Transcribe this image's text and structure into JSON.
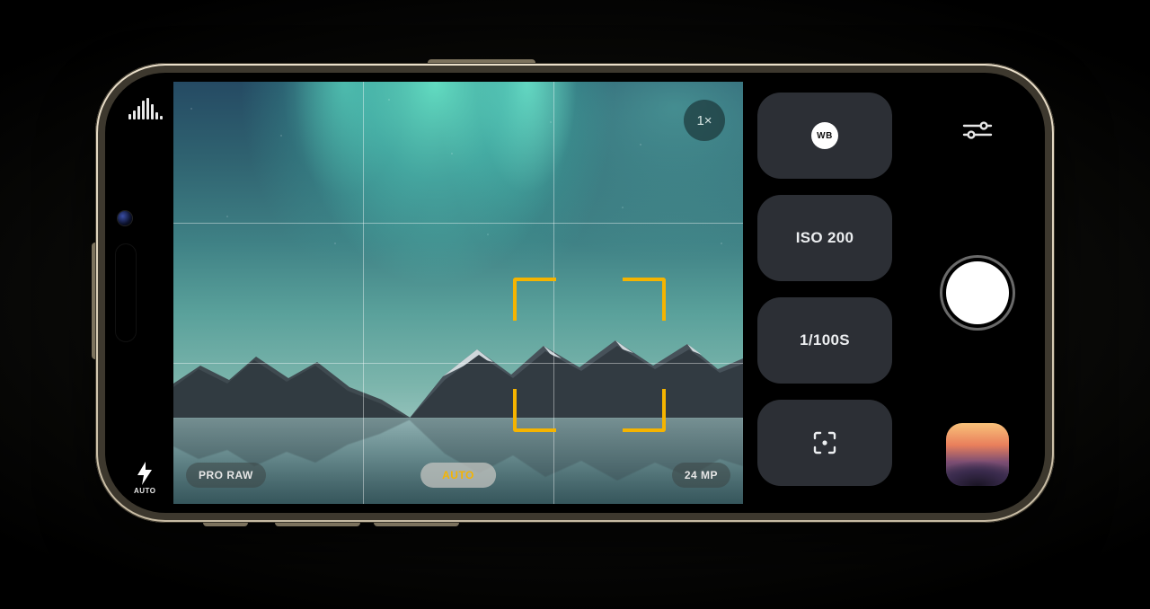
{
  "status": {
    "flash_mode": "AUTO"
  },
  "viewfinder": {
    "zoom_label": "1×",
    "format_pill": "PRO RAW",
    "mode_pill": "AUTO",
    "resolution_pill": "24 MP"
  },
  "controls": {
    "wb_label": "WB",
    "iso_label": "ISO 200",
    "shutter_speed_label": "1/100S"
  },
  "icons": {
    "histogram": "histogram-icon",
    "flash": "flash-icon",
    "sliders": "sliders-icon",
    "focus_target": "focus-target-icon"
  }
}
